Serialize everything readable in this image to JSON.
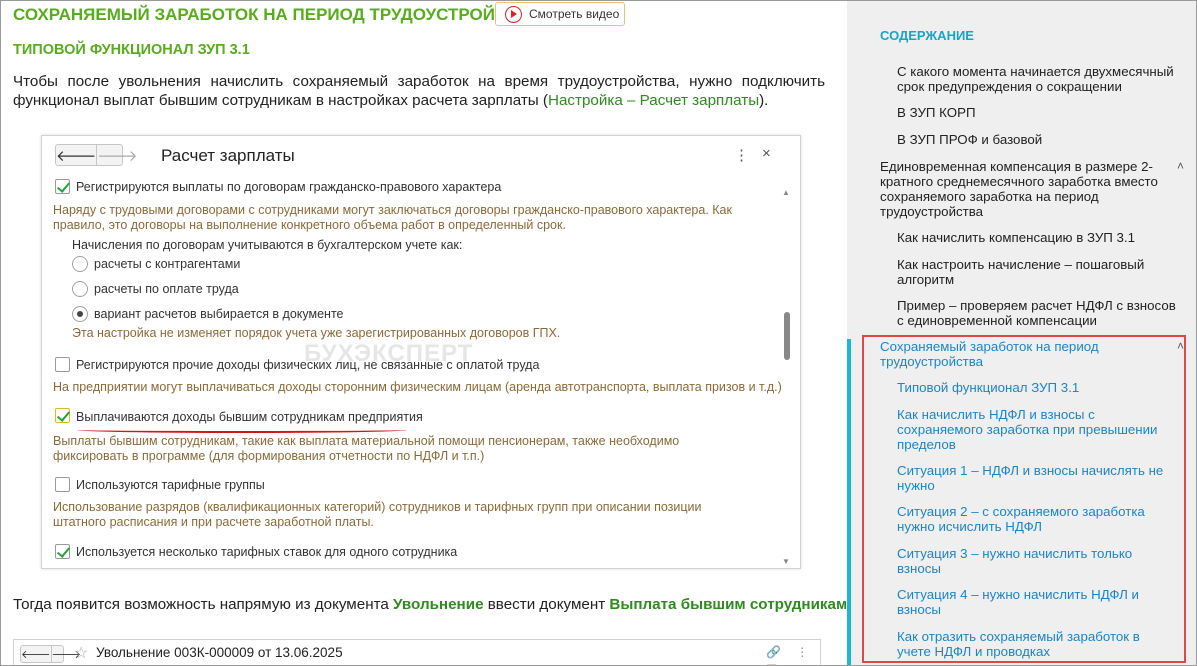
{
  "article": {
    "title": "СОХРАНЯЕМЫЙ ЗАРАБОТОК НА ПЕРИОД ТРУДОУСТРОЙСТВА",
    "video_button": "Смотреть видео",
    "subtitle": "ТИПОВОЙ ФУНКЦИОНАЛ ЗУП 3.1",
    "paragraph1_text": "Чтобы после увольнения начислить сохраняемый заработок на время трудоустройства, нужно подключить функционал выплат бывшим сотрудникам в настройках расчета зарплаты (",
    "paragraph1_link": "Настройка – Расчет зарплаты",
    "paragraph1_end": ").",
    "paragraph2_start": "Тогда появится возможность напрямую из документа ",
    "paragraph2_doc1": "Увольнение",
    "paragraph2_mid": " ввести документ ",
    "paragraph2_doc2": "Выплата бывшим сотрудникам",
    "paragraph2_end": "."
  },
  "window": {
    "back": "🡐",
    "forward": "🡒",
    "title": "Расчет зарплаты",
    "menu": "⋮",
    "close": "×",
    "watermark": "БУХЭКСПЕРТ",
    "option1_label": "Регистрируются выплаты по договорам гражданско-правового характера",
    "option1_hint": "Наряду с трудовыми договорами с сотрудниками могут заключаться договоры гражданско-правового характера. Как правило, это договоры на выполнение конкретного объема работ в определенный срок.",
    "accounting_label": "Начисления по договорам учитываются в бухгалтерском учете как:",
    "radio1": "расчеты с контрагентами",
    "radio2": "расчеты по оплате труда",
    "radio3": "вариант расчетов выбирается в документе",
    "radio_hint": "Эта настройка не изменяет порядок учета уже зарегистрированных договоров ГПХ.",
    "option2_label": "Регистрируются прочие доходы физических лиц, не связанные с оплатой труда",
    "option2_hint": "На предприятии могут выплачиваться доходы сторонним физическим лицам (аренда автотранспорта, выплата призов и т.д.)",
    "option3_label": "Выплачиваются доходы бывшим сотрудникам предприятия",
    "option3_hint": "Выплаты бывшим сотрудникам, такие как выплата материальной помощи пенсионерам, также необходимо фиксировать в программе (для формирования отчетности по НДФЛ и т.п.)",
    "option4_label": "Используются тарифные группы",
    "option4_hint": "Использование разрядов (квалификационных категорий) сотрудников и тарифных групп при описании позиции штатного расписания и при расчете заработной платы.",
    "option5_label": "Используется несколько тарифных ставок для одного сотрудника"
  },
  "window2": {
    "title": "Увольнение 003К-000009 от 13.06.2025",
    "icons": "🔗 ⋮ ▭"
  },
  "sidebar": {
    "title": "СОДЕРЖАНИЕ",
    "items": [
      {
        "label": "С какого момента начинается двухмесячный срок предупреждения о сокращении"
      },
      {
        "label": "В ЗУП КОРП"
      },
      {
        "label": "В ЗУП ПРОФ и базовой"
      },
      {
        "label": "Единовременная компенсация в размере 2-кратного среднемесячного заработка вместо сохраняемого заработка на период трудоустройства"
      },
      {
        "label": "Как начислить компенсацию в ЗУП 3.1"
      },
      {
        "label": "Как настроить начисление – пошаговый алгоритм"
      },
      {
        "label": "Пример – проверяем расчет НДФЛ с взносов с единовременной компенсации"
      },
      {
        "label": "Сохраняемый заработок на период трудоустройства"
      },
      {
        "label": "Типовой функционал ЗУП 3.1"
      },
      {
        "label": "Как начислить НДФЛ и взносы с сохраняемого заработка при превышении пределов"
      },
      {
        "label": "Ситуация 1 – НДФЛ и взносы начислять не нужно"
      },
      {
        "label": "Ситуация 2 – с сохраняемого заработка нужно исчислить НДФЛ"
      },
      {
        "label": "Ситуация 3 – нужно начислить только взносы"
      },
      {
        "label": "Ситуация 4 – нужно начислить НДФЛ и взносы"
      },
      {
        "label": "Как отразить сохраняемый заработок в учете НДФЛ и проводках"
      }
    ],
    "chevron": "˄",
    "accent_color": "#1fb6d4",
    "highlight_color": "#e04848"
  }
}
